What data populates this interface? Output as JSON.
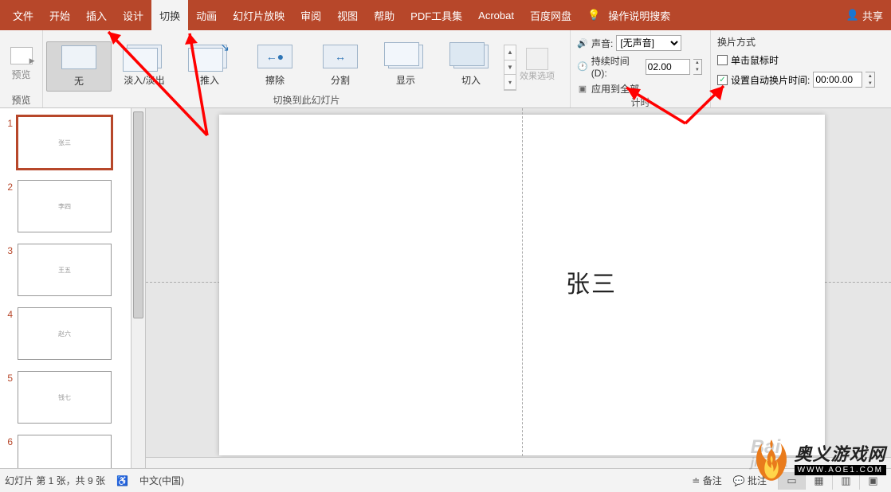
{
  "tabs": {
    "file": "文件",
    "home": "开始",
    "insert": "插入",
    "design": "设计",
    "transitions": "切换",
    "animations": "动画",
    "slideshow": "幻灯片放映",
    "review": "审阅",
    "view": "视图",
    "help": "帮助",
    "pdf": "PDF工具集",
    "acrobat": "Acrobat",
    "baidu": "百度网盘",
    "tell_me": "操作说明搜索",
    "share": "共享"
  },
  "ribbon": {
    "preview_label": "预览",
    "preview_group": "预览",
    "transitions": {
      "none": "无",
      "fade": "淡入/淡出",
      "push": "推入",
      "wipe": "擦除",
      "split": "分割",
      "reveal": "显示",
      "cut": "切入"
    },
    "transition_group": "切换到此幻灯片",
    "effect_options": "效果选项",
    "timing": {
      "sound_label": "声音:",
      "sound_value": "[无声音]",
      "duration_label": "持续时间(D):",
      "duration_value": "02.00",
      "apply_all": "应用到全部",
      "group": "计时"
    },
    "advance": {
      "title": "换片方式",
      "on_click_checked": false,
      "on_click": "单击鼠标时",
      "after_checked": true,
      "after": "设置自动换片时间:",
      "after_value": "00:00.00"
    }
  },
  "slides": [
    {
      "num": "1",
      "text": "张三",
      "active": true
    },
    {
      "num": "2",
      "text": "李四",
      "active": false
    },
    {
      "num": "3",
      "text": "王五",
      "active": false
    },
    {
      "num": "4",
      "text": "赵六",
      "active": false
    },
    {
      "num": "5",
      "text": "钱七",
      "active": false
    },
    {
      "num": "6",
      "text": "",
      "active": false
    }
  ],
  "canvas": {
    "title": "张三"
  },
  "status": {
    "slide_info": "幻灯片 第 1 张，共 9 张",
    "language": "中文(中国)",
    "notes": "备注",
    "comments": "批注"
  },
  "watermark": {
    "baidu_1": "Bai",
    "baidu_2": "jingya",
    "site_cn": "奥义游戏网",
    "site_en": "WWW.AOE1.COM"
  }
}
